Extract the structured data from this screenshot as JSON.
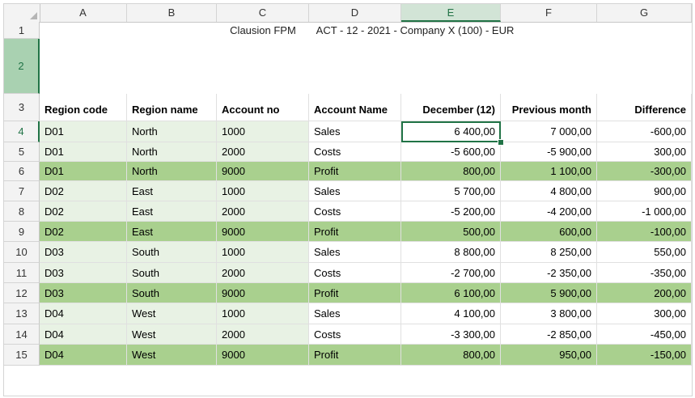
{
  "columns": [
    "A",
    "B",
    "C",
    "D",
    "E",
    "F",
    "G"
  ],
  "row_numbers": [
    "1",
    "2",
    "3",
    "4",
    "5",
    "6",
    "7",
    "8",
    "9",
    "10",
    "11",
    "12",
    "13",
    "14",
    "15"
  ],
  "title": {
    "left": "Clausion FPM",
    "right": "ACT - 12 - 2021 - Company X (100) - EUR"
  },
  "headers": [
    "Region code",
    "Region name",
    "Account no",
    "Account Name",
    "December (12)",
    "Previous month",
    "Difference"
  ],
  "rows": [
    {
      "code": "D01",
      "name": "North",
      "acct": "1000",
      "acct_name": "Sales",
      "dec": "6 400,00",
      "prev": "7 000,00",
      "diff": "-600,00",
      "style": "normal"
    },
    {
      "code": "D01",
      "name": "North",
      "acct": "2000",
      "acct_name": "Costs",
      "dec": "-5 600,00",
      "prev": "-5 900,00",
      "diff": "300,00",
      "style": "normal"
    },
    {
      "code": "D01",
      "name": "North",
      "acct": "9000",
      "acct_name": "Profit",
      "dec": "800,00",
      "prev": "1 100,00",
      "diff": "-300,00",
      "style": "profit"
    },
    {
      "code": "D02",
      "name": "East",
      "acct": "1000",
      "acct_name": "Sales",
      "dec": "5 700,00",
      "prev": "4 800,00",
      "diff": "900,00",
      "style": "normal"
    },
    {
      "code": "D02",
      "name": "East",
      "acct": "2000",
      "acct_name": "Costs",
      "dec": "-5 200,00",
      "prev": "-4 200,00",
      "diff": "-1 000,00",
      "style": "normal"
    },
    {
      "code": "D02",
      "name": "East",
      "acct": "9000",
      "acct_name": "Profit",
      "dec": "500,00",
      "prev": "600,00",
      "diff": "-100,00",
      "style": "profit"
    },
    {
      "code": "D03",
      "name": "South",
      "acct": "1000",
      "acct_name": "Sales",
      "dec": "8 800,00",
      "prev": "8 250,00",
      "diff": "550,00",
      "style": "normal"
    },
    {
      "code": "D03",
      "name": "South",
      "acct": "2000",
      "acct_name": "Costs",
      "dec": "-2 700,00",
      "prev": "-2 350,00",
      "diff": "-350,00",
      "style": "normal"
    },
    {
      "code": "D03",
      "name": "South",
      "acct": "9000",
      "acct_name": "Profit",
      "dec": "6 100,00",
      "prev": "5 900,00",
      "diff": "200,00",
      "style": "profit"
    },
    {
      "code": "D04",
      "name": "West",
      "acct": "1000",
      "acct_name": "Sales",
      "dec": "4 100,00",
      "prev": "3 800,00",
      "diff": "300,00",
      "style": "normal"
    },
    {
      "code": "D04",
      "name": "West",
      "acct": "2000",
      "acct_name": "Costs",
      "dec": "-3 300,00",
      "prev": "-2 850,00",
      "diff": "-450,00",
      "style": "normal"
    },
    {
      "code": "D04",
      "name": "West",
      "acct": "9000",
      "acct_name": "Profit",
      "dec": "800,00",
      "prev": "950,00",
      "diff": "-150,00",
      "style": "profit"
    }
  ],
  "selection": {
    "column": "E",
    "row": "4"
  },
  "colors": {
    "profit_fill": "#a9d08e",
    "light_fill": "#e8f2e4",
    "accent": "#217346"
  }
}
